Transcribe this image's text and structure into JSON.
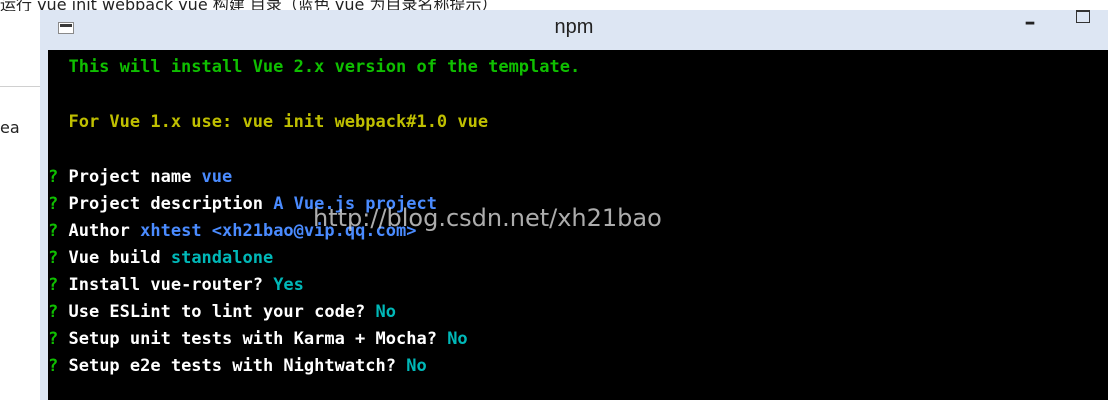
{
  "page": {
    "top_text": "运行    vue init webpack vue 构建 目录（蓝色 vue 为目录名称提示）",
    "left_text": "ea"
  },
  "window": {
    "title": "npm",
    "minimize_label": "–"
  },
  "terminal": {
    "lines": [
      {
        "segments": [
          {
            "text": "  This will install Vue 2.x version of the template.",
            "color": "green"
          }
        ]
      },
      {
        "segments": [
          {
            "text": "  For Vue 1.x use: vue init webpack#1.0 vue",
            "color": "yellow"
          }
        ]
      },
      {
        "segments": [
          {
            "text": "? ",
            "color": "green"
          },
          {
            "text": "Project name ",
            "color": "white"
          },
          {
            "text": "vue",
            "color": "blue"
          }
        ]
      },
      {
        "segments": [
          {
            "text": "? ",
            "color": "green"
          },
          {
            "text": "Project description ",
            "color": "white"
          },
          {
            "text": "A Vue.js project",
            "color": "blue"
          }
        ]
      },
      {
        "segments": [
          {
            "text": "? ",
            "color": "green"
          },
          {
            "text": "Author ",
            "color": "white"
          },
          {
            "text": "xhtest <xh21bao@vip.qq.com>",
            "color": "blue"
          }
        ]
      },
      {
        "segments": [
          {
            "text": "? ",
            "color": "green"
          },
          {
            "text": "Vue build ",
            "color": "white"
          },
          {
            "text": "standalone",
            "color": "teal"
          }
        ]
      },
      {
        "segments": [
          {
            "text": "? ",
            "color": "green"
          },
          {
            "text": "Install vue-router? ",
            "color": "white"
          },
          {
            "text": "Yes",
            "color": "teal"
          }
        ]
      },
      {
        "segments": [
          {
            "text": "? ",
            "color": "green"
          },
          {
            "text": "Use ESLint to lint your code? ",
            "color": "white"
          },
          {
            "text": "No",
            "color": "teal"
          }
        ]
      },
      {
        "segments": [
          {
            "text": "? ",
            "color": "green"
          },
          {
            "text": "Setup unit tests with Karma + Mocha? ",
            "color": "white"
          },
          {
            "text": "No",
            "color": "teal"
          }
        ]
      },
      {
        "segments": [
          {
            "text": "? ",
            "color": "green"
          },
          {
            "text": "Setup e2e tests with Nightwatch? ",
            "color": "white"
          },
          {
            "text": "No",
            "color": "teal"
          }
        ]
      }
    ],
    "colors": {
      "green": "#0fbf00",
      "yellow": "#bfbf00",
      "white": "#ffffff",
      "blue": "#4a8bff",
      "teal": "#00b8b8"
    }
  },
  "watermark": "http://blog.csdn.net/xh21bao"
}
